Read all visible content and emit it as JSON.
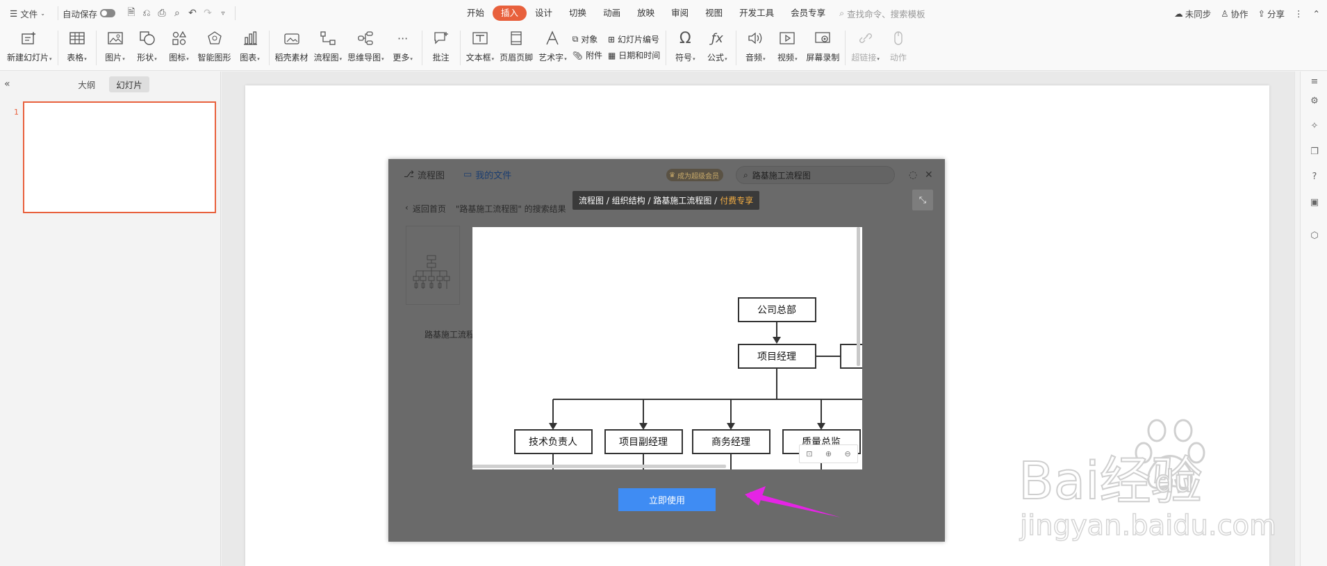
{
  "topbar": {
    "menu_label": "文件",
    "autosave_label": "自动保存",
    "tabs": [
      {
        "label": "开始",
        "active": false
      },
      {
        "label": "插入",
        "active": true
      },
      {
        "label": "设计",
        "active": false
      },
      {
        "label": "切换",
        "active": false
      },
      {
        "label": "动画",
        "active": false
      },
      {
        "label": "放映",
        "active": false
      },
      {
        "label": "审阅",
        "active": false
      },
      {
        "label": "视图",
        "active": false
      },
      {
        "label": "开发工具",
        "active": false
      },
      {
        "label": "会员专享",
        "active": false
      }
    ],
    "search_placeholder": "查找命令、搜索模板",
    "sync_label": "未同步",
    "collab_label": "协作",
    "share_label": "分享"
  },
  "ribbon": {
    "new_slide": "新建幻灯片",
    "table": "表格",
    "picture": "图片",
    "shape": "形状",
    "icon": "图标",
    "smart_graphic": "智能图形",
    "chart": "图表",
    "assets": "稻壳素材",
    "flowchart": "流程图",
    "mindmap": "思维导图",
    "more": "更多",
    "comment": "批注",
    "textbox": "文本框",
    "header_footer": "页眉页脚",
    "wordart": "艺术字",
    "object": "对象",
    "attachment": "附件",
    "slide_number": "幻灯片编号",
    "date_time": "日期和时间",
    "symbol": "符号",
    "formula": "公式",
    "audio": "音频",
    "video": "视频",
    "screen_record": "屏幕录制",
    "hyperlink": "超链接",
    "action": "动作"
  },
  "left_panel": {
    "tab_outline": "大纲",
    "tab_slides": "幻灯片",
    "slide_number": "1"
  },
  "dialog": {
    "tab_flowchart": "流程图",
    "tab_my_files": "我的文件",
    "vip_label": "成为超级会员",
    "search_value": "路基施工流程图",
    "back_label": "返回首页",
    "results_label": "\"路基施工流程图\" 的搜索结果",
    "breadcrumb": "流程图 / 组织结构 / 路基施工流程图 /",
    "breadcrumb_paid": "付费专享",
    "card_label": "路基施工流程",
    "use_button": "立即使用",
    "org": {
      "root": "公司总部",
      "manager": "项目经理",
      "children": [
        "技术负责人",
        "项目副经理",
        "商务经理",
        "质量总监"
      ]
    }
  },
  "watermark": {
    "brand": "Bai经验",
    "brand_du": "du",
    "url": "jingyan.baidu.com"
  }
}
